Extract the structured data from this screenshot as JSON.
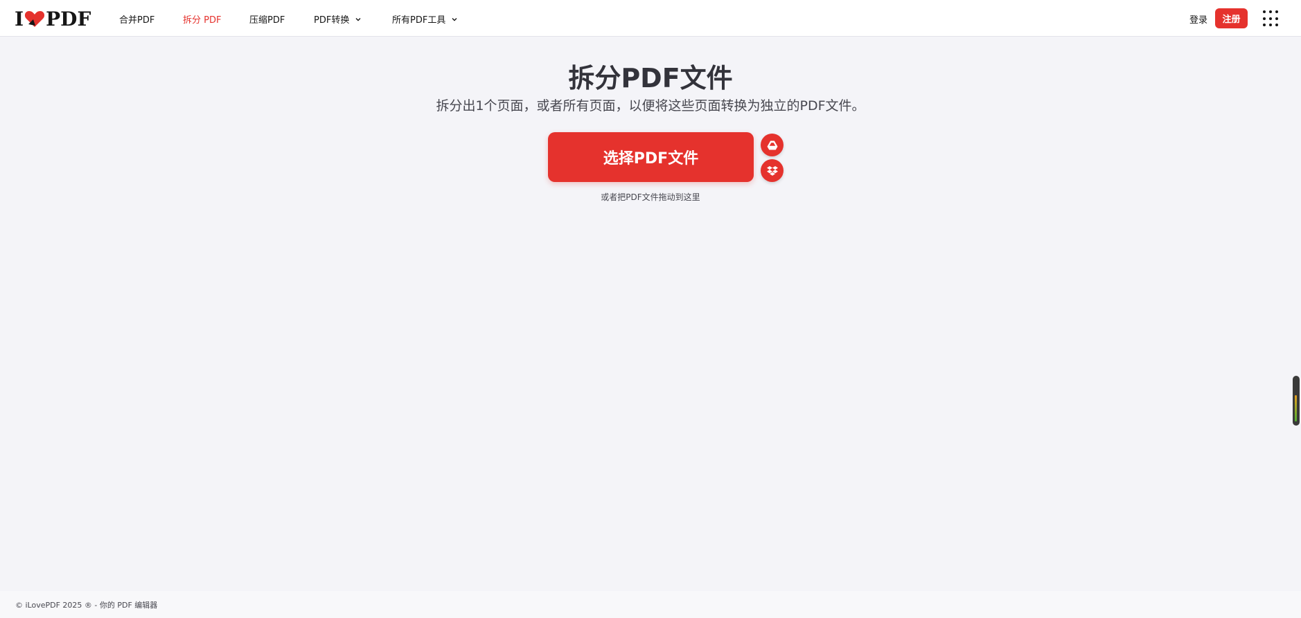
{
  "brand": {
    "logo_left": "I",
    "logo_right": "PDF"
  },
  "nav": {
    "items": [
      {
        "label": "合并PDF",
        "active": false
      },
      {
        "label": "拆分 PDF",
        "active": true
      },
      {
        "label": "压缩PDF",
        "active": false
      },
      {
        "label": "PDF转换",
        "active": false,
        "dropdown": true
      },
      {
        "label": "所有PDF工具",
        "active": false,
        "dropdown": true
      }
    ]
  },
  "header": {
    "login_label": "登录",
    "signup_label": "注册"
  },
  "main": {
    "title": "拆分PDF文件",
    "subtitle": "拆分出1个页面，或者所有页面，以便将这些页面转换为独立的PDF文件。",
    "select_button_label": "选择PDF文件",
    "drop_hint": "或者把PDF文件拖动到这里"
  },
  "footer": {
    "copyright": "© iLovePDF 2025 ® - 你的 PDF 编辑器"
  },
  "colors": {
    "accent": "#e5322d",
    "background": "#f4f4f8",
    "text": "#33333b"
  }
}
